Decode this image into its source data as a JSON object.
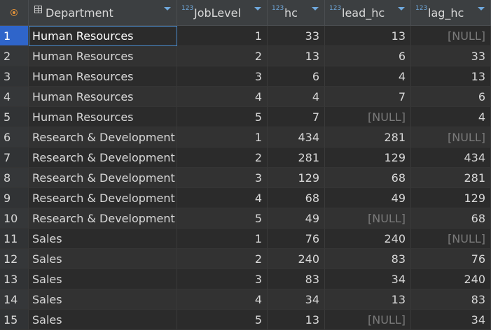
{
  "colors": {
    "background": "#2b2b2b",
    "header_bg": "#3c3f41",
    "selection": "#214283",
    "null_text": "#7a7a7a",
    "type_icon": "#6fa8dc",
    "filter_icon": "#e0913a"
  },
  "header": {
    "type_badge": "123",
    "columns": [
      {
        "key": "Department",
        "label": "Department",
        "icon": "table-icon"
      },
      {
        "key": "JobLevel",
        "label": "JobLevel",
        "icon": "numeric-type-icon"
      },
      {
        "key": "hc",
        "label": "hc",
        "icon": "numeric-type-icon"
      },
      {
        "key": "lead_hc",
        "label": "lead_hc",
        "icon": "numeric-type-icon"
      },
      {
        "key": "lag_hc",
        "label": "lag_hc",
        "icon": "numeric-type-icon"
      }
    ]
  },
  "rows": [
    {
      "n": "1",
      "Department": "Human Resources",
      "JobLevel": "1",
      "hc": "33",
      "lead_hc": "13",
      "lag_hc": "[NULL]"
    },
    {
      "n": "2",
      "Department": "Human Resources",
      "JobLevel": "2",
      "hc": "13",
      "lead_hc": "6",
      "lag_hc": "33"
    },
    {
      "n": "3",
      "Department": "Human Resources",
      "JobLevel": "3",
      "hc": "6",
      "lead_hc": "4",
      "lag_hc": "13"
    },
    {
      "n": "4",
      "Department": "Human Resources",
      "JobLevel": "4",
      "hc": "4",
      "lead_hc": "7",
      "lag_hc": "6"
    },
    {
      "n": "5",
      "Department": "Human Resources",
      "JobLevel": "5",
      "hc": "7",
      "lead_hc": "[NULL]",
      "lag_hc": "4"
    },
    {
      "n": "6",
      "Department": "Research & Development",
      "JobLevel": "1",
      "hc": "434",
      "lead_hc": "281",
      "lag_hc": "[NULL]"
    },
    {
      "n": "7",
      "Department": "Research & Development",
      "JobLevel": "2",
      "hc": "281",
      "lead_hc": "129",
      "lag_hc": "434"
    },
    {
      "n": "8",
      "Department": "Research & Development",
      "JobLevel": "3",
      "hc": "129",
      "lead_hc": "68",
      "lag_hc": "281"
    },
    {
      "n": "9",
      "Department": "Research & Development",
      "JobLevel": "4",
      "hc": "68",
      "lead_hc": "49",
      "lag_hc": "129"
    },
    {
      "n": "10",
      "Department": "Research & Development",
      "JobLevel": "5",
      "hc": "49",
      "lead_hc": "[NULL]",
      "lag_hc": "68"
    },
    {
      "n": "11",
      "Department": "Sales",
      "JobLevel": "1",
      "hc": "76",
      "lead_hc": "240",
      "lag_hc": "[NULL]"
    },
    {
      "n": "12",
      "Department": "Sales",
      "JobLevel": "2",
      "hc": "240",
      "lead_hc": "83",
      "lag_hc": "76"
    },
    {
      "n": "13",
      "Department": "Sales",
      "JobLevel": "3",
      "hc": "83",
      "lead_hc": "34",
      "lag_hc": "240"
    },
    {
      "n": "14",
      "Department": "Sales",
      "JobLevel": "4",
      "hc": "34",
      "lead_hc": "13",
      "lag_hc": "83"
    },
    {
      "n": "15",
      "Department": "Sales",
      "JobLevel": "5",
      "hc": "13",
      "lead_hc": "[NULL]",
      "lag_hc": "34"
    }
  ],
  "selected_row": "1"
}
